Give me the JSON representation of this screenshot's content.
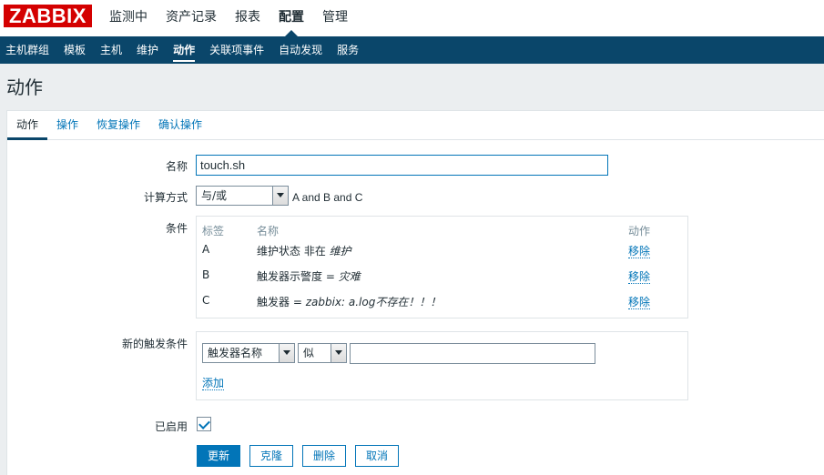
{
  "header": {
    "logo": "ZABBIX",
    "menu": [
      "监测中",
      "资产记录",
      "报表",
      "配置",
      "管理"
    ]
  },
  "submenu": [
    "主机群组",
    "模板",
    "主机",
    "维护",
    "动作",
    "关联项事件",
    "自动发现",
    "服务"
  ],
  "page_title": "动作",
  "tabs": [
    "动作",
    "操作",
    "恢复操作",
    "确认操作"
  ],
  "form": {
    "name_label": "名称",
    "name_value": "touch.sh",
    "calc_label": "计算方式",
    "calc_value": "与/或",
    "calc_formula": "A and B and C",
    "conditions_label": "条件",
    "conditions_headers": {
      "label": "标签",
      "name": "名称",
      "action": "动作"
    },
    "conditions": [
      {
        "label": "A",
        "prefix": "维护状态 非在 ",
        "italic": "维护",
        "action": "移除"
      },
      {
        "label": "B",
        "prefix": "触发器示警度 = ",
        "italic": "灾难",
        "action": "移除"
      },
      {
        "label": "C",
        "prefix": "触发器 = ",
        "italic": "zabbix: a.log不存在！！！",
        "action": "移除"
      }
    ],
    "new_condition_label": "新的触发条件",
    "new_condition_type": "触发器名称",
    "new_condition_operator": "似",
    "new_condition_value": "",
    "add_link": "添加",
    "enabled_label": "已启用",
    "enabled": true
  },
  "buttons": {
    "update": "更新",
    "clone": "克隆",
    "delete": "删除",
    "cancel": "取消"
  }
}
